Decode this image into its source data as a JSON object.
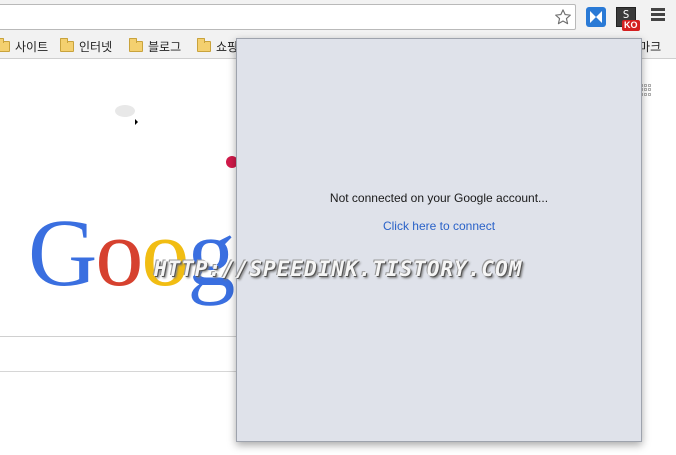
{
  "toolbar": {
    "star_icon": "star-outline",
    "extensions": [
      {
        "name": "speedy-extension",
        "icon": "bowtie-icon",
        "color": "#2a7ad6"
      },
      {
        "name": "s-extension",
        "letter": "S",
        "badge": "KO",
        "badge_color": "#d42020"
      }
    ],
    "menu_icon": "hamburger-menu"
  },
  "bookmarks": [
    {
      "label": "사이트"
    },
    {
      "label": "인터넷"
    },
    {
      "label": "블로그"
    },
    {
      "label": "쇼핑"
    },
    {
      "label": "북마크"
    }
  ],
  "popup": {
    "message": "Not connected on your Google account...",
    "link": "Click here to connect",
    "background": "#dfe2ea",
    "link_color": "#2a62c8"
  },
  "google_logo": {
    "letters": [
      "G",
      "o",
      "o",
      "g"
    ],
    "colors": [
      "#3a6fe0",
      "#d6412f",
      "#f1bd13",
      "#3a6fe0"
    ]
  },
  "watermark": "HTTP://SPEEDINK.TISTORY.COM"
}
